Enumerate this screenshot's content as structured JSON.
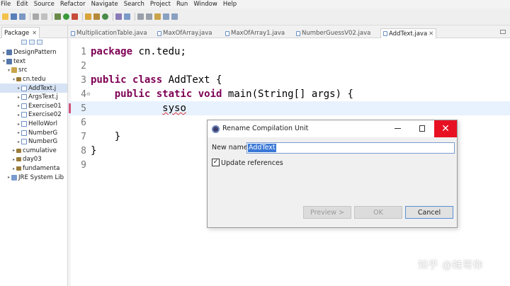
{
  "menu": [
    "File",
    "Edit",
    "Source",
    "Refactor",
    "Navigate",
    "Search",
    "Project",
    "Run",
    "Window",
    "Help"
  ],
  "package_explorer": {
    "tab_label": "Package",
    "tab_close": "✕",
    "tree": [
      {
        "twisty": "▸",
        "icon": "project-icon",
        "label": "DesignPattern",
        "depth": 0
      },
      {
        "twisty": "▾",
        "icon": "project-icon",
        "label": "text",
        "depth": 0
      },
      {
        "twisty": "▾",
        "icon": "source-folder-icon",
        "label": "src",
        "depth": 1
      },
      {
        "twisty": "▾",
        "icon": "package-icon",
        "label": "cn.tedu",
        "depth": 2
      },
      {
        "twisty": "▸",
        "icon": "java-file-icon",
        "label": "AddText.j",
        "depth": 3,
        "selected": true
      },
      {
        "twisty": "▸",
        "icon": "java-file-icon",
        "label": "ArgsText.j",
        "depth": 3
      },
      {
        "twisty": "▸",
        "icon": "java-file-icon",
        "label": "Exercise01",
        "depth": 3
      },
      {
        "twisty": "▸",
        "icon": "java-file-icon",
        "label": "Exercise02",
        "depth": 3
      },
      {
        "twisty": "▸",
        "icon": "java-file-icon",
        "label": "HelloWorl",
        "depth": 3
      },
      {
        "twisty": "▸",
        "icon": "java-file-icon",
        "label": "NumberG",
        "depth": 3
      },
      {
        "twisty": "▸",
        "icon": "java-file-icon",
        "label": "NumberG",
        "depth": 3
      },
      {
        "twisty": "▸",
        "icon": "package-icon",
        "label": "cumulative",
        "depth": 2
      },
      {
        "twisty": "▸",
        "icon": "package-icon",
        "label": "day03",
        "depth": 2
      },
      {
        "twisty": "▸",
        "icon": "package-icon",
        "label": "fundamenta",
        "depth": 2
      },
      {
        "twisty": "▸",
        "icon": "jre-icon",
        "label": "JRE System Lib",
        "depth": 1
      }
    ]
  },
  "editor": {
    "tabs": [
      {
        "label": "MultiplicationTable.java",
        "active": false
      },
      {
        "label": "MaxOfArray.java",
        "active": false
      },
      {
        "label": "MaxOfArray1.java",
        "active": false
      },
      {
        "label": "NumberGuessV02.java",
        "active": false
      },
      {
        "label": "AddText.java",
        "active": true
      }
    ],
    "tab_close": "✕",
    "lines": [
      {
        "num": "1",
        "tokens": [
          {
            "t": "package",
            "k": true
          },
          {
            "t": " cn.tedu;"
          }
        ]
      },
      {
        "num": "2",
        "tokens": []
      },
      {
        "num": "3",
        "tokens": [
          {
            "t": "public",
            "k": true
          },
          {
            "t": " "
          },
          {
            "t": "class",
            "k": true
          },
          {
            "t": " AddText {"
          }
        ]
      },
      {
        "num": "4",
        "fold": "⊖",
        "tokens": [
          {
            "t": "    "
          },
          {
            "t": "public",
            "k": true
          },
          {
            "t": " "
          },
          {
            "t": "static",
            "k": true
          },
          {
            "t": " "
          },
          {
            "t": "void",
            "k": true
          },
          {
            "t": " main(String[] args) {"
          }
        ]
      },
      {
        "num": "5",
        "current": true,
        "tokens": [
          {
            "t": "            "
          },
          {
            "t": "syso",
            "err": true
          }
        ]
      },
      {
        "num": "6",
        "tokens": []
      },
      {
        "num": "7",
        "tokens": [
          {
            "t": "    }"
          }
        ]
      },
      {
        "num": "8",
        "tokens": [
          {
            "t": "}"
          }
        ]
      },
      {
        "num": "9",
        "tokens": []
      }
    ]
  },
  "dialog": {
    "title": "Rename Compilation Unit",
    "close_glyph": "✕",
    "name_label": "New name:",
    "name_value": "AddText",
    "check_glyph": "✓",
    "update_refs_label": "Update references",
    "preview_label": "Preview >",
    "ok_label": "OK",
    "cancel_label": "Cancel"
  },
  "watermark": "知乎 @蛙哥你",
  "colors": {
    "keyword": "#7f0055",
    "selection": "#3a78d6",
    "close": "#e81123",
    "current_line": "#e8f2fe"
  }
}
